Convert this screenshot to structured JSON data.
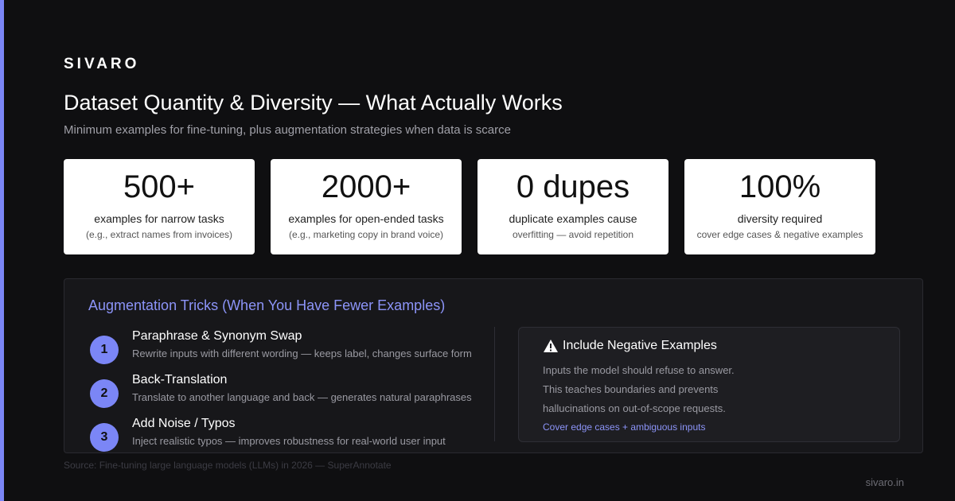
{
  "brand": "SIVARO",
  "title": "Dataset Quantity & Diversity — What Actually Works",
  "subtitle": "Minimum examples for fine-tuning, plus augmentation strategies when data is scarce",
  "stats": [
    {
      "value": "500+",
      "label": "examples for narrow tasks",
      "sub": "(e.g., extract names from invoices)"
    },
    {
      "value": "2000+",
      "label": "examples for open-ended tasks",
      "sub": "(e.g., marketing copy in brand voice)"
    },
    {
      "value": "0 dupes",
      "label": "duplicate examples cause",
      "sub": "overfitting — avoid repetition"
    },
    {
      "value": "100%",
      "label": "diversity required",
      "sub": "cover edge cases & negative examples"
    }
  ],
  "augmentation": {
    "title": "Augmentation Tricks (When You Have Fewer Examples)",
    "tricks": [
      {
        "num": "1",
        "title": "Paraphrase & Synonym Swap",
        "desc": "Rewrite inputs with different wording — keeps label, changes surface form"
      },
      {
        "num": "2",
        "title": "Back-Translation",
        "desc": "Translate to another language and back — generates natural paraphrases"
      },
      {
        "num": "3",
        "title": "Add Noise / Typos",
        "desc": "Inject realistic typos — improves robustness for real-world user input"
      }
    ],
    "negative": {
      "icon": "warning-icon",
      "title": "Include Negative Examples",
      "lines": [
        "Inputs the model should refuse to answer.",
        "This teaches boundaries and prevents",
        "hallucinations on out-of-scope requests."
      ],
      "link": "Cover edge cases + ambiguous inputs"
    }
  },
  "source": "Source: Fine-tuning large language models (LLMs) in 2026 — SuperAnnotate",
  "footer_url": "sivaro.in",
  "colors": {
    "accent": "#7b86f6",
    "background": "#0f0f11",
    "card": "#ffffff",
    "link": "#8c94f8"
  }
}
